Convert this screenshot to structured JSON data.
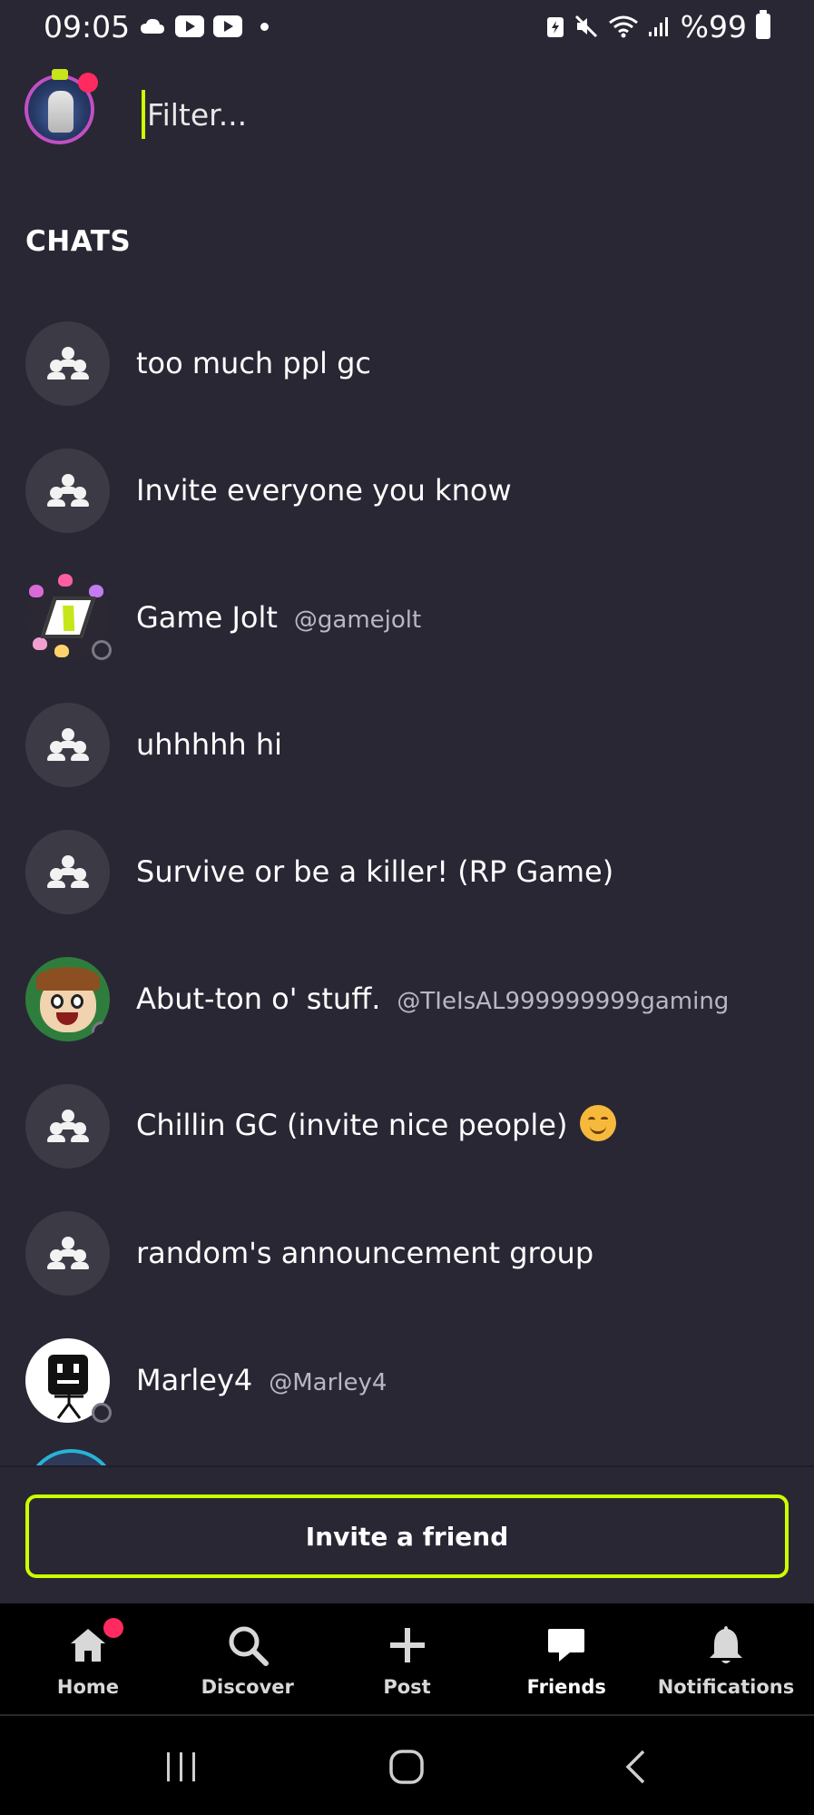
{
  "status_bar": {
    "time": "09:05",
    "battery_text": "%99",
    "left_icons": [
      "cloud-icon",
      "youtube-icon",
      "youtube-icon",
      "dot-icon"
    ],
    "right_icons": [
      "battery-saver-icon",
      "mute-icon",
      "wifi-icon",
      "signal-icon",
      "battery-icon"
    ]
  },
  "header": {
    "filter_placeholder": "Filter..."
  },
  "section_title": "CHATS",
  "chats": [
    {
      "name": "too much ppl gc",
      "handle": "",
      "type": "group"
    },
    {
      "name": "Invite everyone you know",
      "handle": "",
      "type": "group"
    },
    {
      "name": "Game Jolt",
      "handle": "@gamejolt",
      "type": "user"
    },
    {
      "name": "uhhhhh hi",
      "handle": "",
      "type": "group"
    },
    {
      "name": "Survive or be a killer! (RP Game)",
      "handle": "",
      "type": "group"
    },
    {
      "name": "Abut-ton o' stuff.",
      "handle": "@TIeIsAL999999999gaming",
      "type": "user"
    },
    {
      "name": "Chillin GC (invite nice people)",
      "handle": "",
      "type": "group"
    },
    {
      "name": "random's announcement group",
      "handle": "",
      "type": "group"
    },
    {
      "name": "Marley4",
      "handle": "@Marley4",
      "type": "user"
    }
  ],
  "invite_button": "Invite a friend",
  "bottom_nav": [
    {
      "label": "Home",
      "icon": "home-icon"
    },
    {
      "label": "Discover",
      "icon": "search-icon"
    },
    {
      "label": "Post",
      "icon": "plus-icon"
    },
    {
      "label": "Friends",
      "icon": "chat-bubble-icon",
      "active": true
    },
    {
      "label": "Notifications",
      "icon": "bell-icon"
    }
  ],
  "colors": {
    "background": "#292734",
    "accent": "#ccff00",
    "badge": "#ff2a5f",
    "nav_background": "#000000"
  }
}
